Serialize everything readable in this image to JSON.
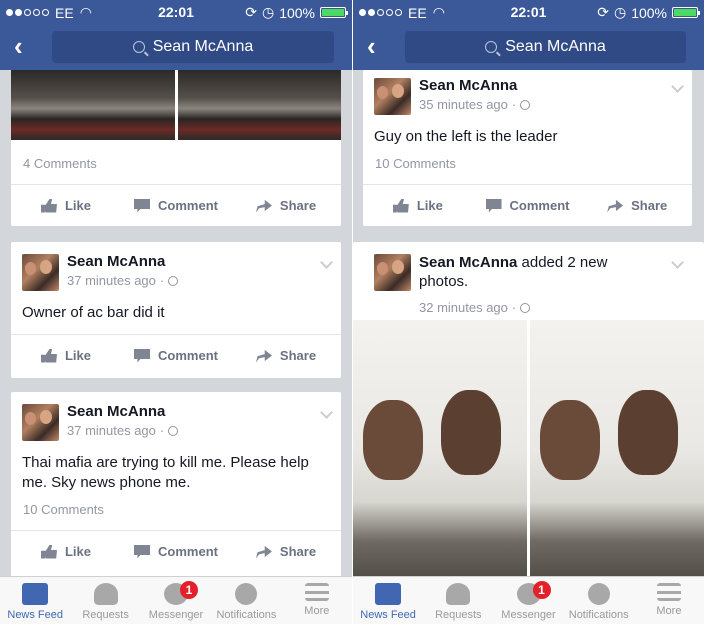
{
  "status": {
    "carrier": "EE",
    "time": "22:01",
    "battery": "100%"
  },
  "search": {
    "query": "Sean McAnna"
  },
  "left": {
    "top_card": {
      "comments": "4 Comments"
    },
    "post1": {
      "author": "Sean McAnna",
      "time": "37 minutes ago",
      "text": "Owner of ac bar did it"
    },
    "post2": {
      "author": "Sean McAnna",
      "time": "37 minutes ago",
      "text": "Thai mafia are trying to kill me. Please help me. Sky news phone me.",
      "comments": "10 Comments"
    }
  },
  "right": {
    "post1": {
      "author": "Sean McAnna",
      "time": "35 minutes ago",
      "text": "Guy on the left is the leader",
      "comments": "10 Comments"
    },
    "post2": {
      "author": "Sean McAnna",
      "action": " added 2 new photos.",
      "time": "32 minutes ago"
    }
  },
  "actions": {
    "like": "Like",
    "comment": "Comment",
    "share": "Share"
  },
  "tabs": [
    {
      "label": "News Feed",
      "icon": "news-feed-icon"
    },
    {
      "label": "Requests",
      "icon": "requests-icon"
    },
    {
      "label": "Messenger",
      "icon": "messenger-icon",
      "badge": "1"
    },
    {
      "label": "Notifications",
      "icon": "globe-icon"
    },
    {
      "label": "More",
      "icon": "menu-icon"
    }
  ],
  "colors": {
    "brand": "#3b5998",
    "active_tab": "#4267b2",
    "badge": "#e3202a"
  }
}
